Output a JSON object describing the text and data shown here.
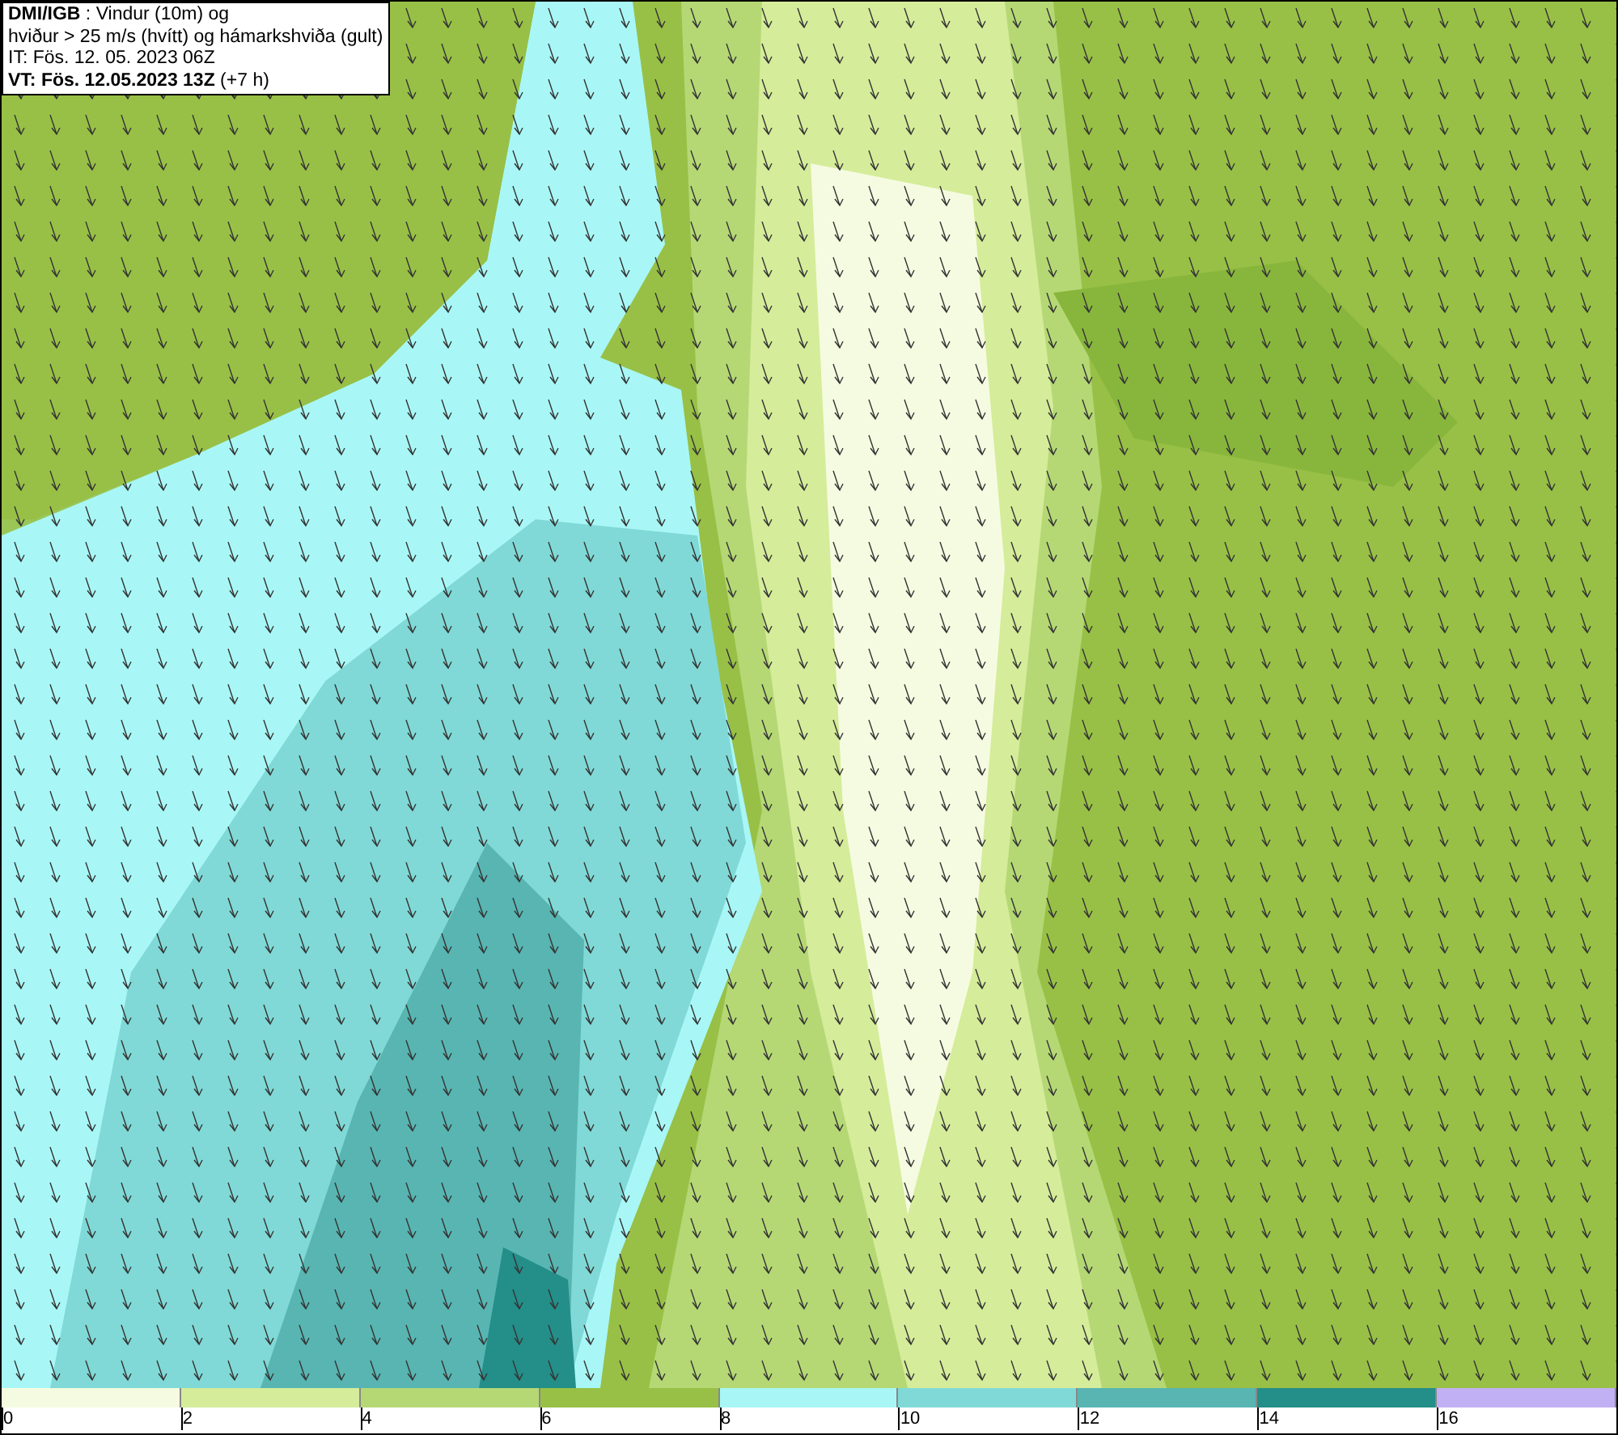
{
  "info_box": {
    "lines": [
      "**DMI/IGB** : Vindur (10m) og",
      "hviður > 25 m/s (hvítt) og hámarkshviða (gult)",
      "IT: Fös. 12. 05. 2023 06Z",
      "**VT: Fös. 12.05.2023 13Z** (+7 h)"
    ]
  },
  "legend": [
    {
      "label": "0",
      "color": "#f5fbe0"
    },
    {
      "label": "2",
      "color": "#d5ec9a"
    },
    {
      "label": "4",
      "color": "#b5d875"
    },
    {
      "label": "6",
      "color": "#98c046"
    },
    {
      "label": "8",
      "color": "#a8f7f6"
    },
    {
      "label": "10",
      "color": "#80d9d6"
    },
    {
      "label": "12",
      "color": "#58b5b2"
    },
    {
      "label": "14",
      "color": "#248e89"
    },
    {
      "label": "16",
      "color": "#c2b0f5"
    }
  ]
}
